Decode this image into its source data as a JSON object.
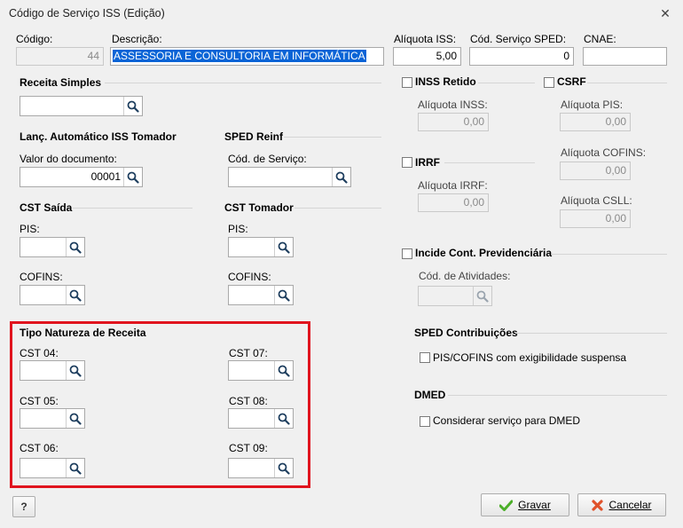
{
  "window": {
    "title": "Código de Serviço ISS (Edição)"
  },
  "header": {
    "codigo_label": "Código:",
    "codigo_value": "44",
    "descricao_label": "Descrição:",
    "descricao_value": "ASSESSORIA E CONSULTORIA EM INFORMÁTICA",
    "aliquota_label": "Alíquota ISS:",
    "aliquota_value": "5,00",
    "sped_label": "Cód. Serviço SPED:",
    "sped_value": "0",
    "cnae_label": "CNAE:",
    "cnae_value": ""
  },
  "receita_simples": {
    "title": "Receita Simples"
  },
  "lanc_auto": {
    "title": "Lanç. Automático ISS Tomador",
    "valor_label": "Valor do documento:",
    "valor_value": "00001"
  },
  "sped_reinf": {
    "title": "SPED Reinf",
    "cod_label": "Cód. de Serviço:"
  },
  "cst_saida": {
    "title": "CST Saída",
    "pis_label": "PIS:",
    "cofins_label": "COFINS:"
  },
  "cst_tomador": {
    "title": "CST Tomador",
    "pis_label": "PIS:",
    "cofins_label": "COFINS:"
  },
  "natureza": {
    "title": "Tipo Natureza de Receita",
    "cst04": "CST 04:",
    "cst05": "CST 05:",
    "cst06": "CST 06:",
    "cst07": "CST 07:",
    "cst08": "CST 08:",
    "cst09": "CST 09:"
  },
  "inss": {
    "title": "INSS Retido",
    "aliquota_label": "Alíquota INSS:",
    "aliquota_value": "0,00"
  },
  "csrf": {
    "title": "CSRF",
    "pis_label": "Alíquota PIS:",
    "pis_value": "0,00",
    "cofins_label": "Alíquota COFINS:",
    "cofins_value": "0,00",
    "csll_label": "Alíquota CSLL:",
    "csll_value": "0,00"
  },
  "irrf": {
    "title": "IRRF",
    "aliquota_label": "Alíquota IRRF:",
    "aliquota_value": "0,00"
  },
  "previdenciaria": {
    "title": "Incide Cont. Previdenciária",
    "atividades_label": "Cód. de Atividades:"
  },
  "sped_contrib": {
    "title": "SPED Contribuições",
    "check_label": "PIS/COFINS com exigibilidade suspensa"
  },
  "dmed": {
    "title": "DMED",
    "check_label": "Considerar serviço para DMED"
  },
  "buttons": {
    "help": "?",
    "gravar": "Gravar",
    "cancelar": "Cancelar"
  },
  "colors": {
    "highlight": "#e0141e",
    "selection": "#0a64d6",
    "ok_icon": "#4caf2a",
    "cancel_icon": "#e0522b"
  }
}
